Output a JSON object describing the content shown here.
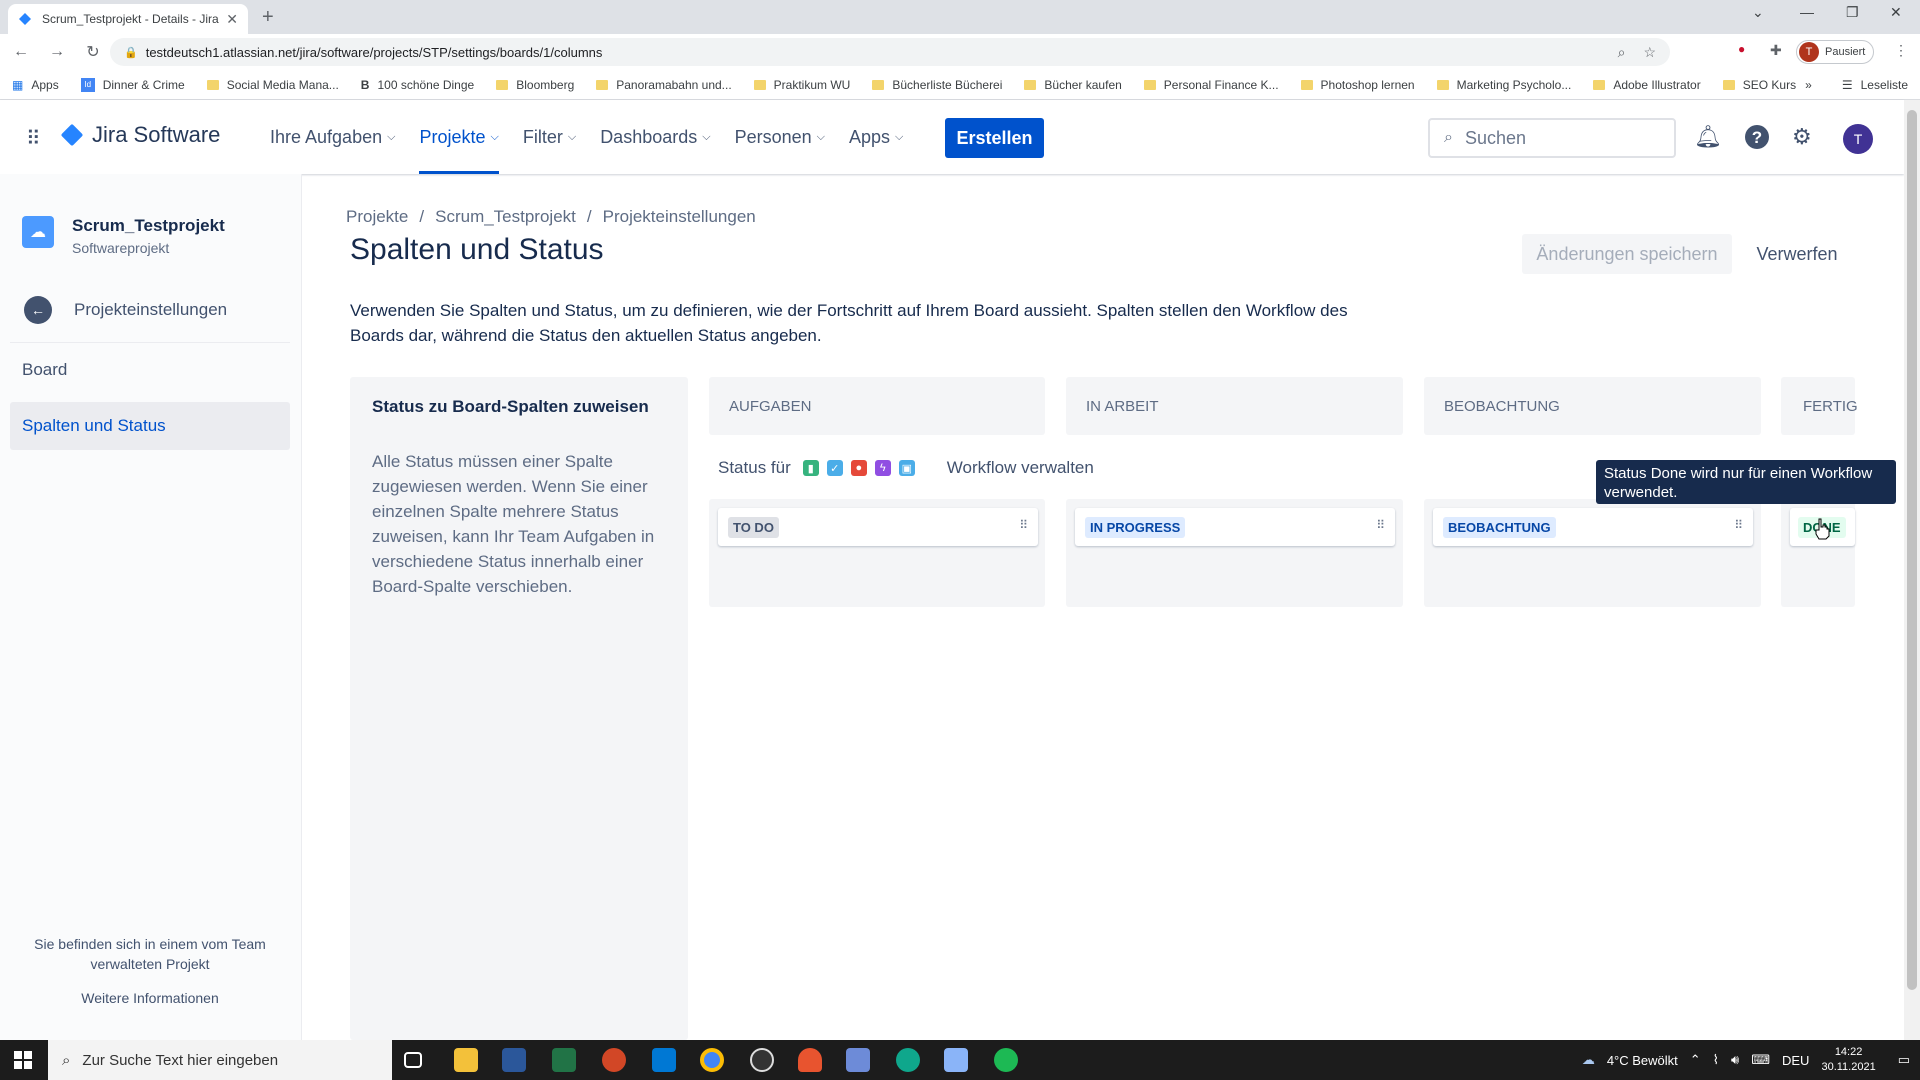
{
  "browser": {
    "tab_title": "Scrum_Testprojekt - Details - Jira",
    "url": "testdeutsch1.atlassian.net/jira/software/projects/STP/settings/boards/1/columns",
    "profile_label": "Pausiert",
    "profile_initial": "T",
    "bookmarks": [
      "Apps",
      "Dinner & Crime",
      "Social Media Mana...",
      "100 schöne Dinge",
      "Bloomberg",
      "Panoramabahn und...",
      "Praktikum WU",
      "Bücherliste Bücherei",
      "Bücher kaufen",
      "Personal Finance K...",
      "Photoshop lernen",
      "Marketing Psycholo...",
      "Adobe Illustrator",
      "SEO Kurs"
    ],
    "reading_list": "Leseliste"
  },
  "jira": {
    "logo_text": "Jira Software",
    "nav": [
      "Ihre Aufgaben",
      "Projekte",
      "Filter",
      "Dashboards",
      "Personen",
      "Apps"
    ],
    "create_label": "Erstellen",
    "search_placeholder": "Suchen",
    "avatar_initial": "T"
  },
  "sidebar": {
    "project_name": "Scrum_Testprojekt",
    "project_type": "Softwareprojekt",
    "back_label": "Projekteinstellungen",
    "section": "Board",
    "active_item": "Spalten und Status",
    "footer_text": "Sie befinden sich in einem vom Team verwalteten Projekt",
    "footer_link": "Weitere Informationen"
  },
  "main": {
    "breadcrumbs": [
      "Projekte",
      "Scrum_Testprojekt",
      "Projekteinstellungen"
    ],
    "title": "Spalten und Status",
    "save_label": "Änderungen speichern",
    "discard_label": "Verwerfen",
    "description": "Verwenden Sie Spalten und Status, um zu definieren, wie der Fortschritt auf Ihrem Board aussieht. Spalten stellen den Workflow des Boards dar, während die Status den aktuellen Status angeben.",
    "assign_title": "Status zu Board-Spalten zuweisen",
    "assign_text": "Alle Status müssen einer Spalte zugewiesen werden. Wenn Sie einer einzelnen Spalte mehrere Status zuweisen, kann Ihr Team Aufgaben in verschiedene Status innerhalb einer Board-Spalte verschieben.",
    "status_for_label": "Status für",
    "workflow_link": "Workflow verwalten",
    "columns": [
      {
        "header": "AUFGABEN",
        "status": "TO DO"
      },
      {
        "header": "IN ARBEIT",
        "status": "IN PROGRESS"
      },
      {
        "header": "BEOBACHTUNG",
        "status": "BEOBACHTUNG"
      },
      {
        "header": "FERTIG",
        "status": "DONE"
      }
    ],
    "tooltip": "Status Done wird nur für einen Workflow verwendet."
  },
  "taskbar": {
    "search_placeholder": "Zur Suche Text hier eingeben",
    "weather": "4°C  Bewölkt",
    "lang": "DEU",
    "time": "14:22",
    "date": "30.11.2021"
  },
  "colors": {
    "primary": "#0052cc",
    "issue_story": "#36b37e",
    "issue_task": "#4bade8",
    "issue_bug": "#e5493a",
    "issue_epic": "#904ee2",
    "issue_subtask": "#4bade8"
  }
}
